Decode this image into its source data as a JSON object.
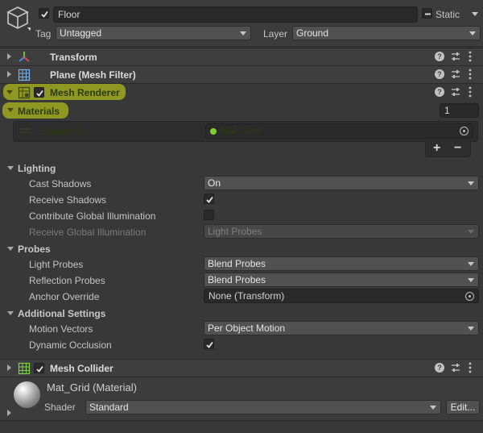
{
  "object": {
    "name": "Floor",
    "active": true,
    "static_label": "Static",
    "tag_label": "Tag",
    "tag_value": "Untagged",
    "layer_label": "Layer",
    "layer_value": "Ground"
  },
  "components": {
    "transform": {
      "title": "Transform"
    },
    "mesh_filter": {
      "title": "Plane (Mesh Filter)"
    },
    "mesh_renderer": {
      "title": "Mesh Renderer",
      "enabled": true
    },
    "mesh_collider": {
      "title": "Mesh Collider",
      "enabled": true
    }
  },
  "materials": {
    "label": "Materials",
    "size": "1",
    "element_label": "Element 0",
    "element_value": "Mat_Grid",
    "add_label": "+",
    "remove_label": "−"
  },
  "lighting": {
    "label": "Lighting",
    "cast_shadows_label": "Cast Shadows",
    "cast_shadows_value": "On",
    "receive_shadows_label": "Receive Shadows",
    "receive_shadows": true,
    "contribute_gi_label": "Contribute Global Illumination",
    "contribute_gi": false,
    "receive_gi_label": "Receive Global Illumination",
    "receive_gi_value": "Light Probes"
  },
  "probes": {
    "label": "Probes",
    "light_probes_label": "Light Probes",
    "light_probes_value": "Blend Probes",
    "reflection_probes_label": "Reflection Probes",
    "reflection_probes_value": "Blend Probes",
    "anchor_override_label": "Anchor Override",
    "anchor_override_value": "None (Transform)"
  },
  "additional": {
    "label": "Additional Settings",
    "motion_vectors_label": "Motion Vectors",
    "motion_vectors_value": "Per Object Motion",
    "dynamic_occlusion_label": "Dynamic Occlusion",
    "dynamic_occlusion": true
  },
  "material_asset": {
    "title": "Mat_Grid (Material)",
    "shader_label": "Shader",
    "shader_value": "Standard",
    "edit_label": "Edit..."
  },
  "colors": {
    "background": "#383838",
    "header": "#3e3e3e",
    "field": "#2a2a2a",
    "dropdown": "#515151",
    "highlight": "#d4e414",
    "asset_dot": "#7fd02a"
  }
}
